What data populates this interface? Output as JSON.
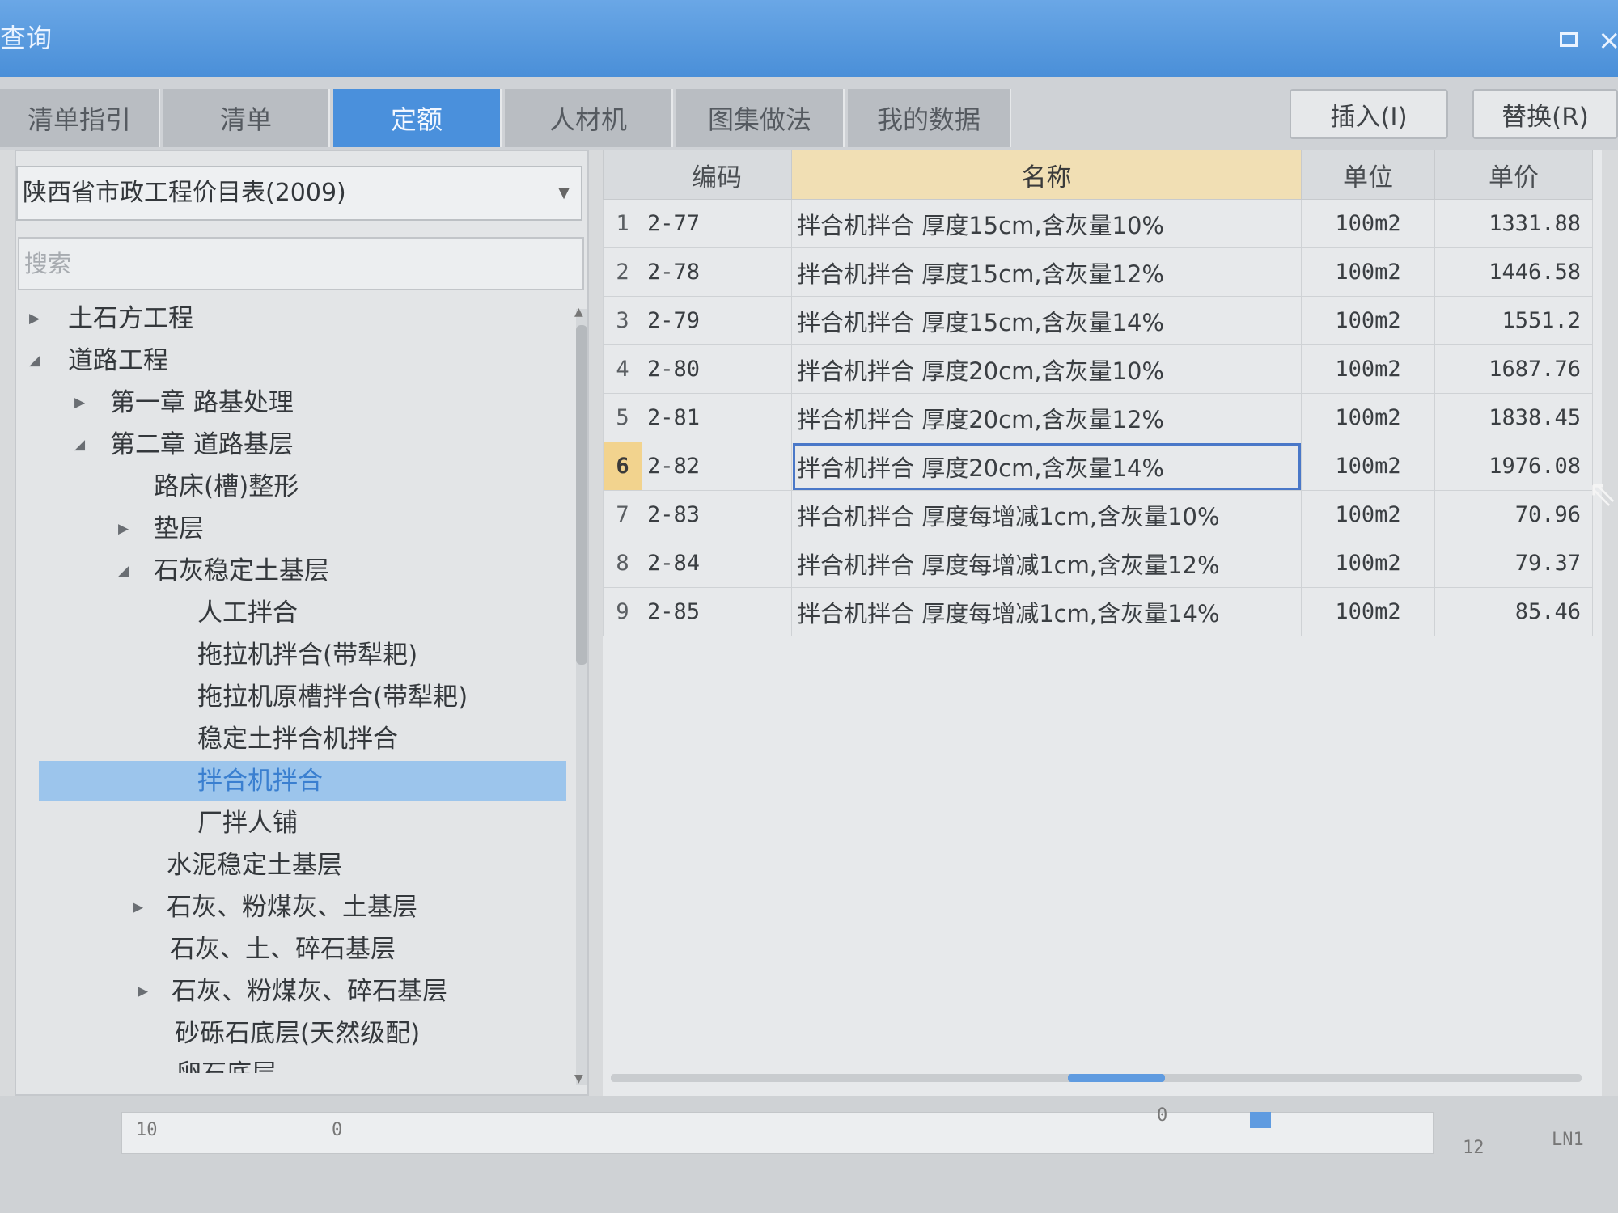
{
  "window": {
    "title": "查询"
  },
  "tabs": [
    {
      "label": "清单指引",
      "active": false
    },
    {
      "label": "清单",
      "active": false
    },
    {
      "label": "定额",
      "active": true
    },
    {
      "label": "人材机",
      "active": false
    },
    {
      "label": "图集做法",
      "active": false
    },
    {
      "label": "我的数据",
      "active": false
    }
  ],
  "toolbar": {
    "insert_label": "插入(I)",
    "replace_label": "替换(R)"
  },
  "library": {
    "selected": "陕西省市政工程价目表(2009)"
  },
  "search": {
    "placeholder": "搜索"
  },
  "tree": [
    {
      "label": "土石方工程",
      "toggle": "▶"
    },
    {
      "label": "道路工程",
      "toggle": "◢"
    },
    {
      "label": "第一章 路基处理",
      "toggle": "▶"
    },
    {
      "label": "第二章 道路基层",
      "toggle": "◢"
    },
    {
      "label": "路床(槽)整形",
      "toggle": ""
    },
    {
      "label": "垫层",
      "toggle": "▶"
    },
    {
      "label": "石灰稳定土基层",
      "toggle": "◢"
    },
    {
      "label": "人工拌合",
      "toggle": ""
    },
    {
      "label": "拖拉机拌合(带犁耙)",
      "toggle": ""
    },
    {
      "label": "拖拉机原槽拌合(带犁耙)",
      "toggle": ""
    },
    {
      "label": "稳定土拌合机拌合",
      "toggle": ""
    },
    {
      "label": "拌合机拌合",
      "toggle": "",
      "selected": true
    },
    {
      "label": "厂拌人铺",
      "toggle": ""
    },
    {
      "label": "水泥稳定土基层",
      "toggle": ""
    },
    {
      "label": "石灰、粉煤灰、土基层",
      "toggle": "▶"
    },
    {
      "label": "石灰、土、碎石基层",
      "toggle": ""
    },
    {
      "label": "石灰、粉煤灰、碎石基层",
      "toggle": "▶"
    },
    {
      "label": "砂砾石底层(天然级配)",
      "toggle": ""
    },
    {
      "label": "卵石底层",
      "toggle": ""
    }
  ],
  "grid": {
    "headers": {
      "code": "编码",
      "name": "名称",
      "unit": "单位",
      "price": "单价"
    },
    "rows": [
      {
        "num": "1",
        "code": "2-77",
        "name": "拌合机拌合 厚度15cm,含灰量10%",
        "unit": "100m2",
        "price": "1331.88"
      },
      {
        "num": "2",
        "code": "2-78",
        "name": "拌合机拌合 厚度15cm,含灰量12%",
        "unit": "100m2",
        "price": "1446.58"
      },
      {
        "num": "3",
        "code": "2-79",
        "name": "拌合机拌合 厚度15cm,含灰量14%",
        "unit": "100m2",
        "price": "1551.2"
      },
      {
        "num": "4",
        "code": "2-80",
        "name": "拌合机拌合 厚度20cm,含灰量10%",
        "unit": "100m2",
        "price": "1687.76"
      },
      {
        "num": "5",
        "code": "2-81",
        "name": "拌合机拌合 厚度20cm,含灰量12%",
        "unit": "100m2",
        "price": "1838.45"
      },
      {
        "num": "6",
        "code": "2-82",
        "name": "拌合机拌合 厚度20cm,含灰量14%",
        "unit": "100m2",
        "price": "1976.08",
        "current": true
      },
      {
        "num": "7",
        "code": "2-83",
        "name": "拌合机拌合 厚度每增减1cm,含灰量10%",
        "unit": "100m2",
        "price": "70.96"
      },
      {
        "num": "8",
        "code": "2-84",
        "name": "拌合机拌合 厚度每增减1cm,含灰量12%",
        "unit": "100m2",
        "price": "79.37"
      },
      {
        "num": "9",
        "code": "2-85",
        "name": "拌合机拌合 厚度每增减1cm,含灰量14%",
        "unit": "100m2",
        "price": "85.46"
      }
    ]
  },
  "background": {
    "row_num": "10",
    "zero_a": "0",
    "zero_b": "0",
    "row12": "12",
    "code12": "LN1"
  },
  "colors": {
    "titlebar": "#4a8fd8",
    "active_tab": "#4a90dc",
    "selected_node": "#9cc5ec",
    "name_header": "#f1dfb4"
  }
}
